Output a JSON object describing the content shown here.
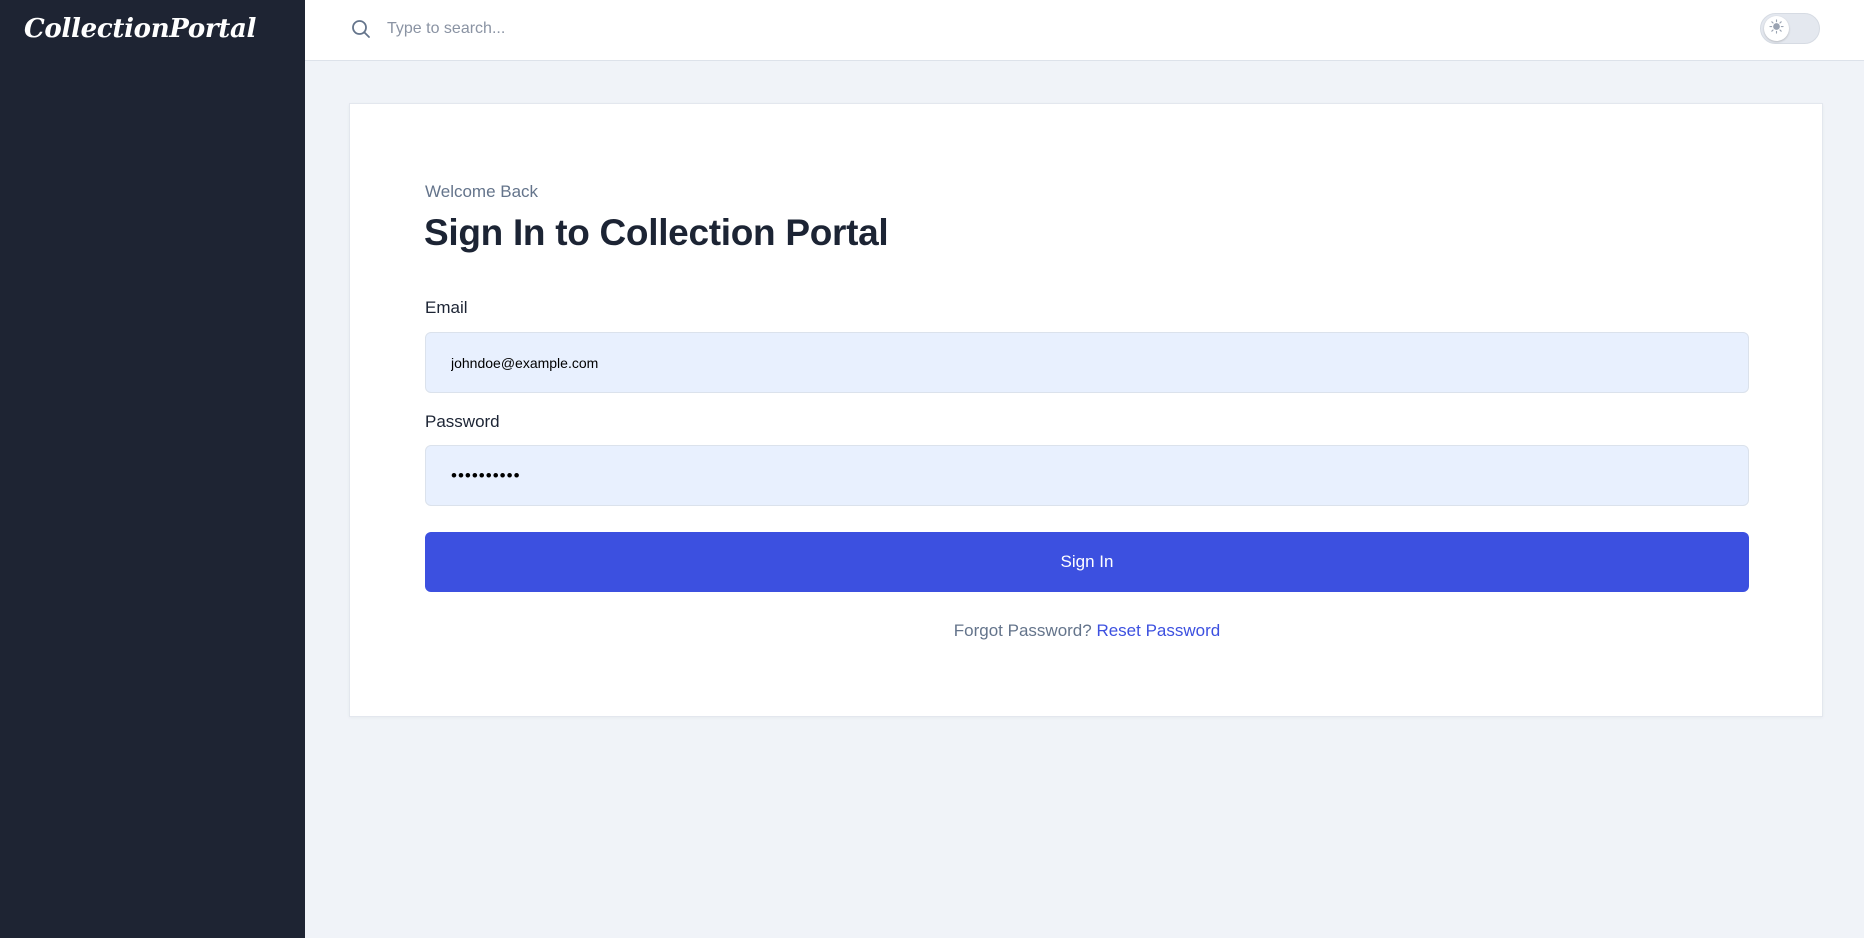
{
  "sidebar": {
    "logo_text": "CollectionPortal"
  },
  "header": {
    "search": {
      "placeholder": "Type to search...",
      "value": ""
    },
    "theme_toggle": {
      "icon": "sun-icon",
      "state": "light"
    }
  },
  "login": {
    "welcome_text": "Welcome Back",
    "title": "Sign In to Collection Portal",
    "email_label": "Email",
    "email_value": "johndoe@example.com",
    "password_label": "Password",
    "password_value": "••••••••••",
    "submit_label": "Sign In",
    "forgot_text": "Forgot Password?",
    "reset_link_text": "Reset Password"
  },
  "colors": {
    "sidebar_bg": "#1e2433",
    "page_bg": "#f0f3f8",
    "primary": "#3c50e0",
    "input_bg": "#e8f0fe",
    "text_dark": "#1c2434",
    "text_muted": "#64748b"
  }
}
